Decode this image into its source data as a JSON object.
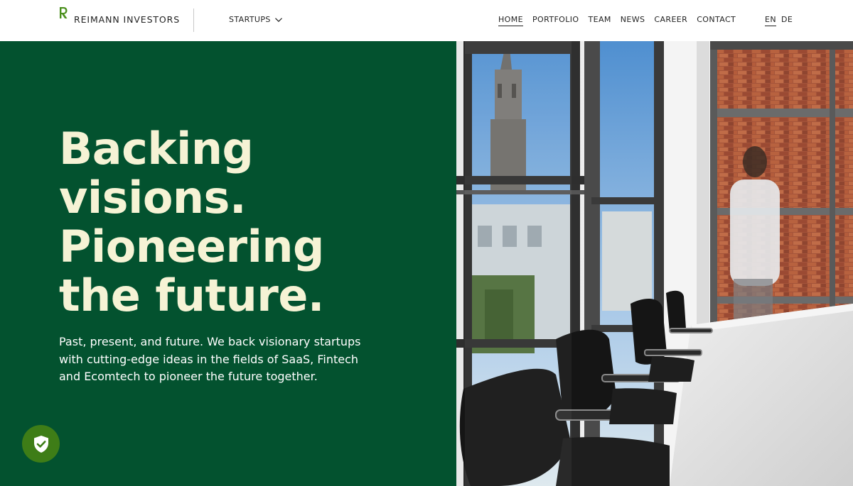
{
  "header": {
    "logo_text": "REIMANN INVESTORS",
    "startups_label": "STARTUPS",
    "nav": [
      {
        "label": "HOME",
        "active": true
      },
      {
        "label": "PORTFOLIO",
        "active": false
      },
      {
        "label": "TEAM",
        "active": false
      },
      {
        "label": "NEWS",
        "active": false
      },
      {
        "label": "CAREER",
        "active": false
      },
      {
        "label": "CONTACT",
        "active": false
      }
    ],
    "languages": [
      {
        "label": "EN",
        "active": true
      },
      {
        "label": "DE",
        "active": false
      }
    ]
  },
  "hero": {
    "title_lines": [
      "Backing",
      "visions.",
      "Pioneering",
      "the future."
    ],
    "description": "Past, present, and future. We back visionary startups with cutting-edge ideas in the fields of SaaS, Fintech and Ecomtech to pioneer the future together."
  },
  "colors": {
    "brand_green": "#03522f",
    "title_cream": "#f6f3d5",
    "badge_green": "#3e7d17",
    "logo_green": "#4a8f1c"
  },
  "icons": {
    "logo": "reimann-r-logo-icon",
    "dropdown": "chevron-down-icon",
    "badge": "shield-check-icon"
  }
}
